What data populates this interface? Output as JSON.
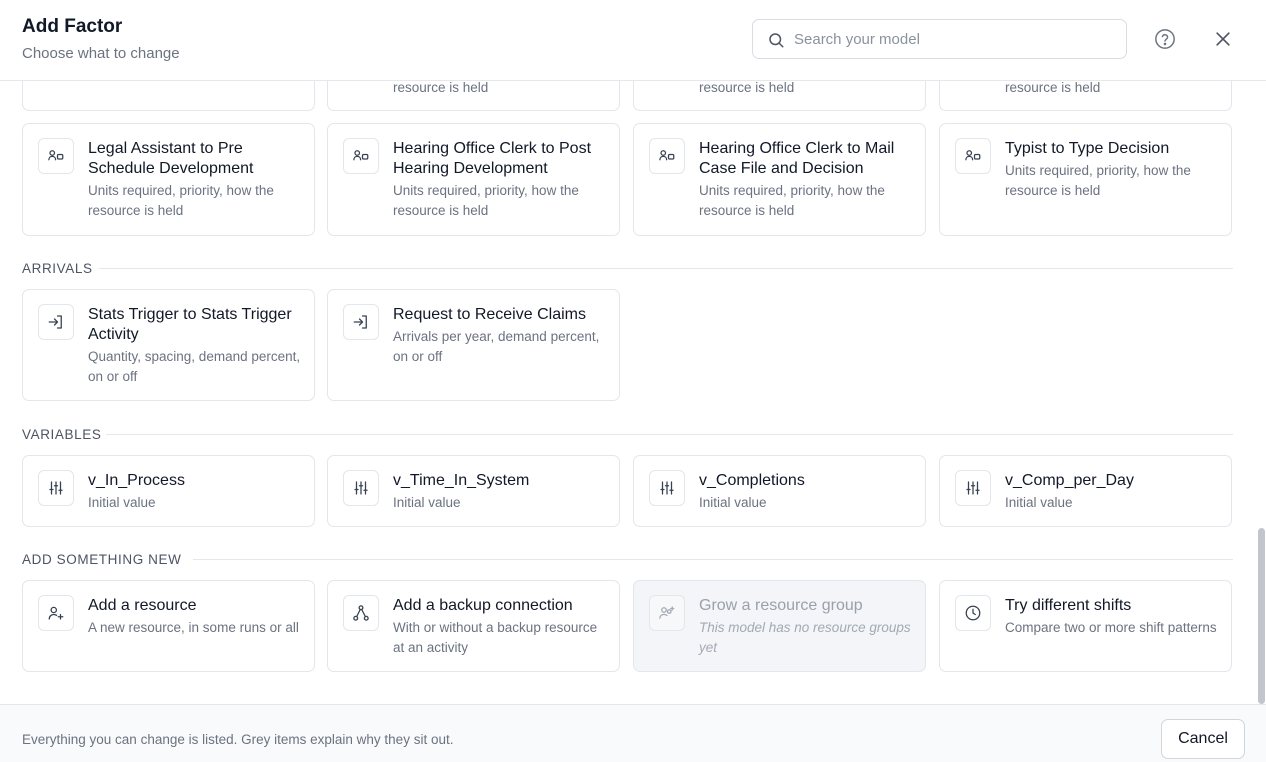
{
  "header": {
    "title": "Add Factor",
    "subtitle": "Choose what to change",
    "search_placeholder": "Search your model"
  },
  "top_partial_cards": [
    {
      "desc": ""
    },
    {
      "desc": "resource is held"
    },
    {
      "desc": "resource is held"
    },
    {
      "desc": "resource is held"
    }
  ],
  "resource_cards": [
    {
      "title": "Legal Assistant to Pre Schedule Development",
      "desc": "Units required, priority, how the resource is held",
      "icon": "resource-link-icon"
    },
    {
      "title": "Hearing Office Clerk to Post Hearing Development",
      "desc": "Units required, priority, how the resource is held",
      "icon": "resource-link-icon"
    },
    {
      "title": "Hearing Office Clerk to Mail Case File and Decision",
      "desc": "Units required, priority, how the resource is held",
      "icon": "resource-link-icon"
    },
    {
      "title": "Typist to Type Decision",
      "desc": "Units required, priority, how the resource is held",
      "icon": "resource-link-icon"
    }
  ],
  "sections": {
    "arrivals": "ARRIVALS",
    "variables": "VARIABLES",
    "add_new": "ADD SOMETHING NEW"
  },
  "arrival_cards": [
    {
      "title": "Stats Trigger to Stats Trigger Activity",
      "desc": "Quantity, spacing, demand percent, on or off",
      "icon": "arrival-enter-icon"
    },
    {
      "title": "Request to Receive Claims",
      "desc": "Arrivals per year, demand percent, on or off",
      "icon": "arrival-enter-icon"
    }
  ],
  "variable_cards": [
    {
      "title": "v_In_Process",
      "desc": "Initial value",
      "icon": "sliders-icon"
    },
    {
      "title": "v_Time_In_System",
      "desc": "Initial value",
      "icon": "sliders-icon"
    },
    {
      "title": "v_Completions",
      "desc": "Initial value",
      "icon": "sliders-icon"
    },
    {
      "title": "v_Comp_per_Day",
      "desc": "Initial value",
      "icon": "sliders-icon"
    }
  ],
  "new_cards": [
    {
      "title": "Add a resource",
      "desc": "A new resource, in some runs or all",
      "icon": "user-plus-icon",
      "disabled": false
    },
    {
      "title": "Add a backup connection",
      "desc": "With or without a backup resource at an activity",
      "icon": "network-icon",
      "disabled": false
    },
    {
      "title": "Grow a resource group",
      "desc": "This model has no resource groups yet",
      "icon": "users-plus-icon",
      "disabled": true
    },
    {
      "title": "Try different shifts",
      "desc": "Compare two or more shift patterns",
      "icon": "clock-icon",
      "disabled": false
    }
  ],
  "footer": {
    "note": "Everything you can change is listed. Grey items explain why they sit out.",
    "cancel_label": "Cancel"
  },
  "colors": {
    "border": "#e3e6ea",
    "disabled_bg": "#f3f5f8",
    "text_primary": "#111827",
    "text_secondary": "#6b7280"
  }
}
